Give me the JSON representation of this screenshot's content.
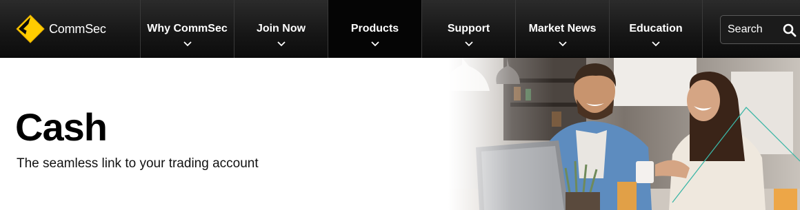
{
  "brand": {
    "name": "CommSec",
    "color": "#FFCC00",
    "icon": "commbank-diamond-icon"
  },
  "nav": {
    "items": [
      {
        "label": "Why CommSec",
        "active": false
      },
      {
        "label": "Join Now",
        "active": false
      },
      {
        "label": "Products",
        "active": true
      },
      {
        "label": "Support",
        "active": false
      },
      {
        "label": "Market News",
        "active": false
      },
      {
        "label": "Education",
        "active": false
      }
    ]
  },
  "search": {
    "label": "Search",
    "icon": "search-icon"
  },
  "hero": {
    "title": "Cash",
    "subtitle": "The seamless link to your trading account",
    "image": "photo-couple-laughing-cafe"
  },
  "colors": {
    "header_bg": "#1a1a1a",
    "accent_line": "#3bb6a6"
  }
}
